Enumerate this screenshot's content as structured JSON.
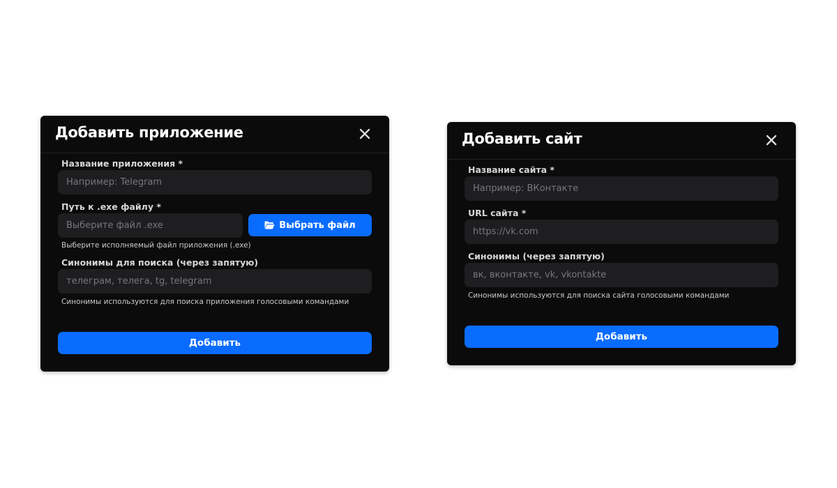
{
  "app_modal": {
    "title": "Добавить приложение",
    "name_label": "Название приложения *",
    "name_placeholder": "Например: Telegram",
    "path_label": "Путь к .exe файлу *",
    "path_placeholder": "Выберите файл .exe",
    "choose_file_label": "Выбрать файл",
    "path_hint": "Выберите исполняемый файл приложения (.exe)",
    "synonyms_label": "Синонимы для поиска (через запятую)",
    "synonyms_placeholder": "телеграм, телега, tg, telegram",
    "synonyms_hint": "Синонимы используются для поиска приложения голосовыми командами",
    "submit_label": "Добавить"
  },
  "site_modal": {
    "title": "Добавить сайт",
    "name_label": "Название сайта *",
    "name_placeholder": "Например: ВКонтакте",
    "url_label": "URL сайта *",
    "url_placeholder": "https://vk.com",
    "synonyms_label": "Синонимы (через запятую)",
    "synonyms_placeholder": "вк, вконтакте, vk, vkontakte",
    "synonyms_hint": "Синонимы используются для поиска сайта голосовыми командами",
    "submit_label": "Добавить"
  },
  "icons": {
    "close": "close-icon",
    "folder": "folder-open-icon"
  },
  "colors": {
    "background": "#ffffff",
    "modal": "#0b0b0c",
    "input": "#1e1e20",
    "accent": "#0a6cff"
  }
}
